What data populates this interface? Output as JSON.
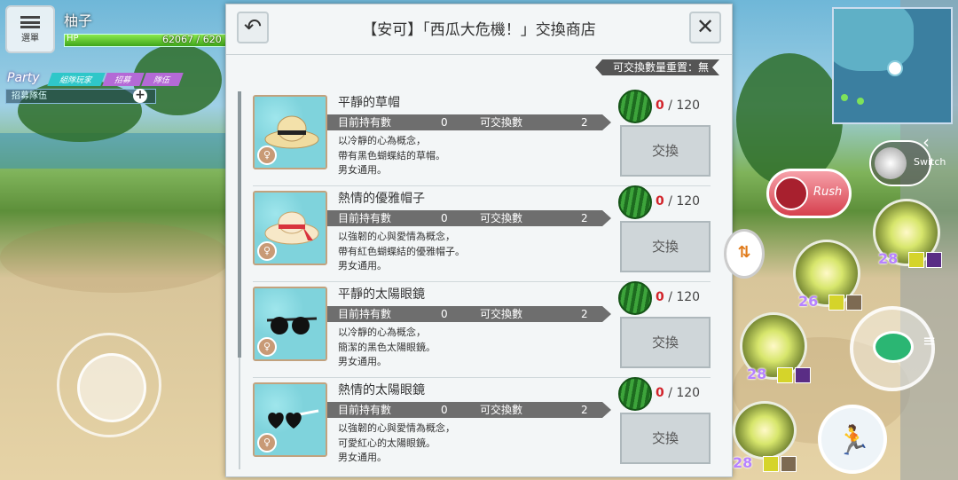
{
  "hud": {
    "menu_label": "選單",
    "player_name": "柚子",
    "hp_label": "HP",
    "hp_text": "62067 / 620",
    "party_label": "Party",
    "party_tabs": [
      "組隊玩家",
      "招募",
      "隊伍"
    ],
    "party_invite": "招募隊伍"
  },
  "shop": {
    "back_icon": "undo-arrow-icon",
    "title": "【安可】「西瓜大危機！」交換商店",
    "close_icon": "close-icon",
    "reset_label": "可交換數量重置：無",
    "owned_label": "目前持有數",
    "exchangeable_label": "可交換數",
    "exchange_button": "交換",
    "currency_icon": "watermelon-icon",
    "items": [
      {
        "name": "平靜的草帽",
        "owned": "0",
        "exchangeable": "2",
        "desc": [
          "以冷靜的心為概念，",
          "帶有黑色蝴蝶結的草帽。",
          "男女通用。"
        ],
        "cost_have": "0",
        "cost_need": "/ 120",
        "icon": "straw-hat-icon"
      },
      {
        "name": "熱情的優雅帽子",
        "owned": "0",
        "exchangeable": "2",
        "desc": [
          "以強韌的心與愛情為概念，",
          "帶有紅色蝴蝶結的優雅帽子。",
          "男女通用。"
        ],
        "cost_have": "0",
        "cost_need": "/ 120",
        "icon": "elegant-hat-icon"
      },
      {
        "name": "平靜的太陽眼鏡",
        "owned": "0",
        "exchangeable": "2",
        "desc": [
          "以冷靜的心為概念，",
          "簡潔的黑色太陽眼鏡。",
          "男女通用。"
        ],
        "cost_have": "0",
        "cost_need": "/ 120",
        "icon": "black-sunglasses-icon"
      },
      {
        "name": "熱情的太陽眼鏡",
        "owned": "0",
        "exchangeable": "2",
        "desc": [
          "以強韌的心與愛情為概念，",
          "可愛紅心的太陽眼鏡。",
          "男女通用。"
        ],
        "cost_have": "0",
        "cost_need": "/ 120",
        "icon": "heart-sunglasses-icon"
      }
    ]
  },
  "controls": {
    "switch_label": "Switch",
    "rush_label": "Rush",
    "skills": [
      {
        "level": "28"
      },
      {
        "level": "26"
      },
      {
        "level": "28"
      },
      {
        "level": "28"
      }
    ]
  },
  "colors": {
    "hp_green": "#3fa51a",
    "cost_red": "#d2232a",
    "rush_pink": "#d6404e",
    "skill_level_purple": "#b783ff"
  }
}
